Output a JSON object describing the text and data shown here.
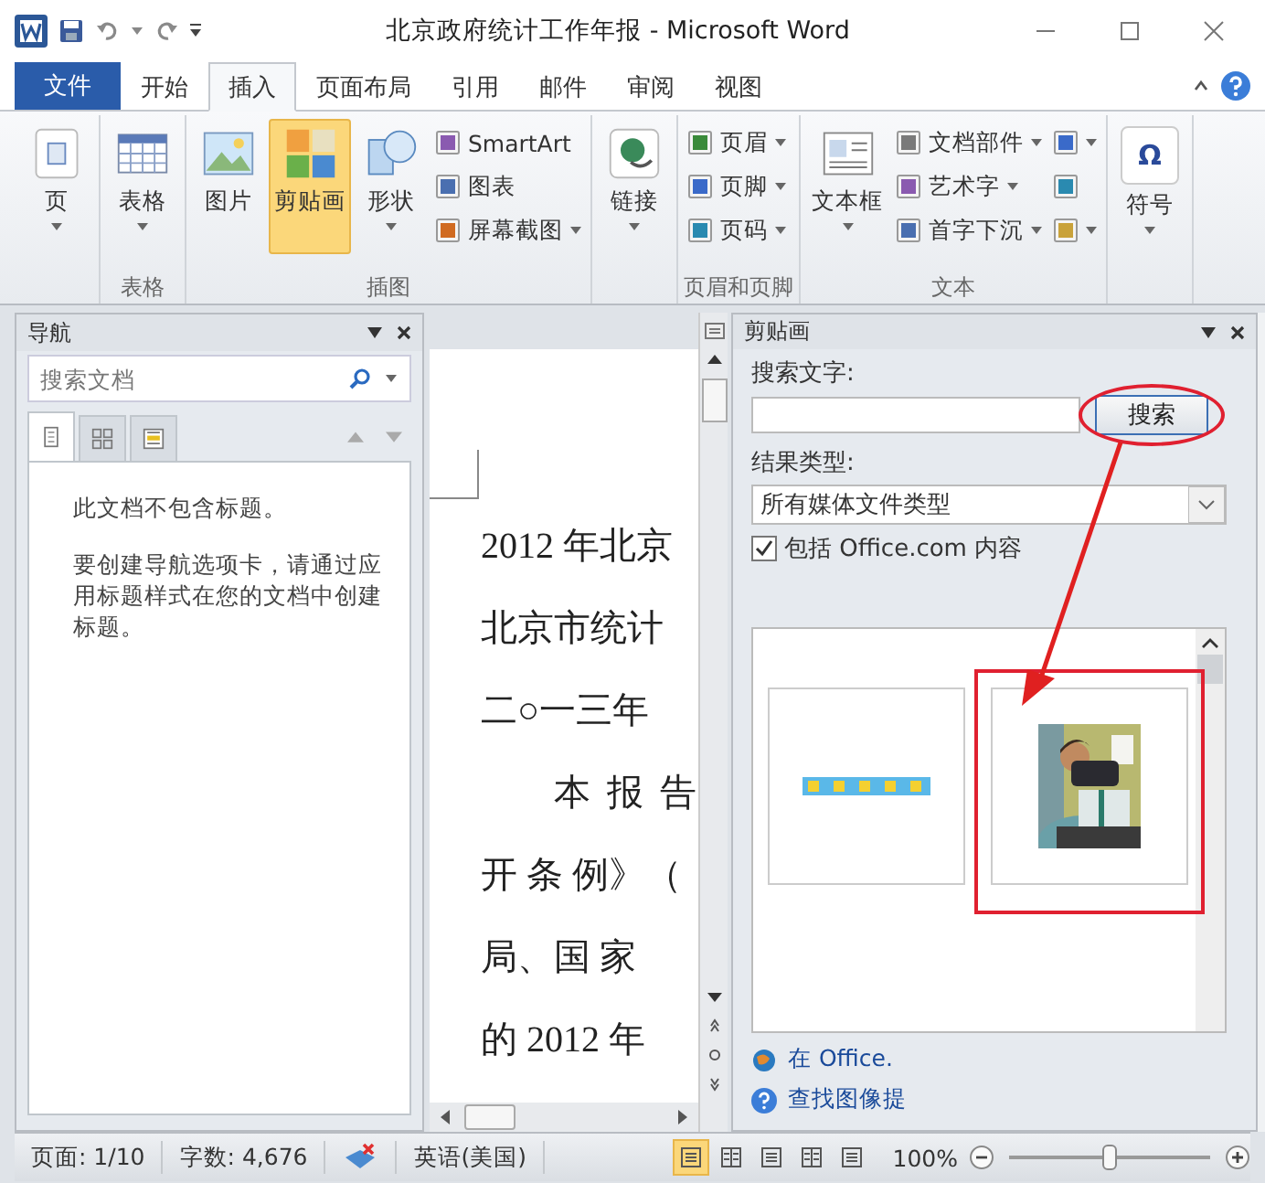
{
  "window": {
    "title": "北京政府统计工作年报 - Microsoft Word"
  },
  "file_tab": {
    "label": "文件"
  },
  "ribbon_tabs": [
    {
      "label": "开始",
      "selected": false
    },
    {
      "label": "插入",
      "selected": true
    },
    {
      "label": "页面布局",
      "selected": false
    },
    {
      "label": "引用",
      "selected": false
    },
    {
      "label": "邮件",
      "selected": false
    },
    {
      "label": "审阅",
      "selected": false
    },
    {
      "label": "视图",
      "selected": false
    }
  ],
  "ribbon_groups": [
    {
      "buttons": [
        {
          "kind": "large",
          "label": "页",
          "dropdown": true,
          "selected": false
        }
      ]
    },
    {
      "label": "表格",
      "buttons": [
        {
          "kind": "large",
          "label": "表格",
          "dropdown": true,
          "selected": false
        }
      ]
    },
    {
      "label": "插图",
      "buttons": [
        {
          "kind": "large",
          "label": "图片",
          "dropdown": false,
          "selected": false
        },
        {
          "kind": "large",
          "label": "剪贴画",
          "dropdown": false,
          "selected": true
        },
        {
          "kind": "large",
          "label": "形状",
          "dropdown": true,
          "selected": false
        },
        {
          "kind": "stack",
          "rows": [
            {
              "label": "SmartArt",
              "dropdown": false
            },
            {
              "label": "图表",
              "dropdown": false
            },
            {
              "label": "屏幕截图",
              "dropdown": true
            }
          ]
        }
      ]
    },
    {
      "buttons": [
        {
          "kind": "large",
          "label": "链接",
          "dropdown": true,
          "selected": false
        }
      ]
    },
    {
      "label": "页眉和页脚",
      "buttons": [
        {
          "kind": "stack",
          "rows": [
            {
              "label": "页眉",
              "dropdown": true
            },
            {
              "label": "页脚",
              "dropdown": true
            },
            {
              "label": "页码",
              "dropdown": true
            }
          ]
        }
      ]
    },
    {
      "label": "文本",
      "buttons": [
        {
          "kind": "large",
          "label": "文本框",
          "dropdown": true,
          "selected": false
        },
        {
          "kind": "stack",
          "rows": [
            {
              "label": "文档部件",
              "dropdown": true
            },
            {
              "label": "艺术字",
              "dropdown": true
            },
            {
              "label": "首字下沉",
              "dropdown": true
            }
          ]
        },
        {
          "kind": "stack",
          "rows": [
            {
              "dropdown": true
            },
            {
              "dropdown": false
            },
            {
              "dropdown": true
            }
          ]
        }
      ]
    },
    {
      "buttons": [
        {
          "kind": "large",
          "label": "符号",
          "glyph": "Ω",
          "dropdown": true,
          "selected": false
        }
      ]
    }
  ],
  "navigation_pane": {
    "title": "导航",
    "search": {
      "placeholder": "搜索文档"
    },
    "tabs": [
      {
        "selected": true
      },
      {
        "selected": false
      },
      {
        "selected": false
      }
    ],
    "paragraphs": [
      "此文档不包含标题。",
      "要创建导航选项卡，请通过应用标题样式在您的文档中创建标题。"
    ]
  },
  "document": {
    "lines": [
      {
        "text": "2012 年北京",
        "indent": false
      },
      {
        "text": "北京市统计",
        "indent": false
      },
      {
        "text": "二○一三年",
        "indent": false
      },
      {
        "text": "本 报 告",
        "indent": true
      },
      {
        "text": "开 条 例》（",
        "indent": false
      },
      {
        "text": "局、国 家",
        "indent": false
      },
      {
        "text": "的 2012 年",
        "indent": false
      }
    ]
  },
  "clip_art_pane": {
    "title": "剪贴画",
    "search_label": "搜索文字:",
    "search_button": {
      "label": "搜索",
      "circled": true
    },
    "result_type_label": "结果类型:",
    "result_type": "所有媒体文件类型",
    "include_office": {
      "label": "包括 Office.com 内容",
      "checked": true
    },
    "results": [
      {
        "kind": "strip",
        "marked": false
      },
      {
        "kind": "picture",
        "marked": true
      }
    ],
    "callout_arrow": true,
    "links": [
      "在 Office.",
      "查找图像提"
    ]
  },
  "status_bar": {
    "page": "页面: 1/10",
    "words": "字数: 4,676",
    "language": "英语(美国)",
    "views": [
      {
        "selected": true
      },
      {
        "selected": false
      },
      {
        "selected": false
      },
      {
        "selected": false
      },
      {
        "selected": false
      }
    ],
    "zoom": {
      "label": "100%",
      "level": 0.5
    }
  }
}
